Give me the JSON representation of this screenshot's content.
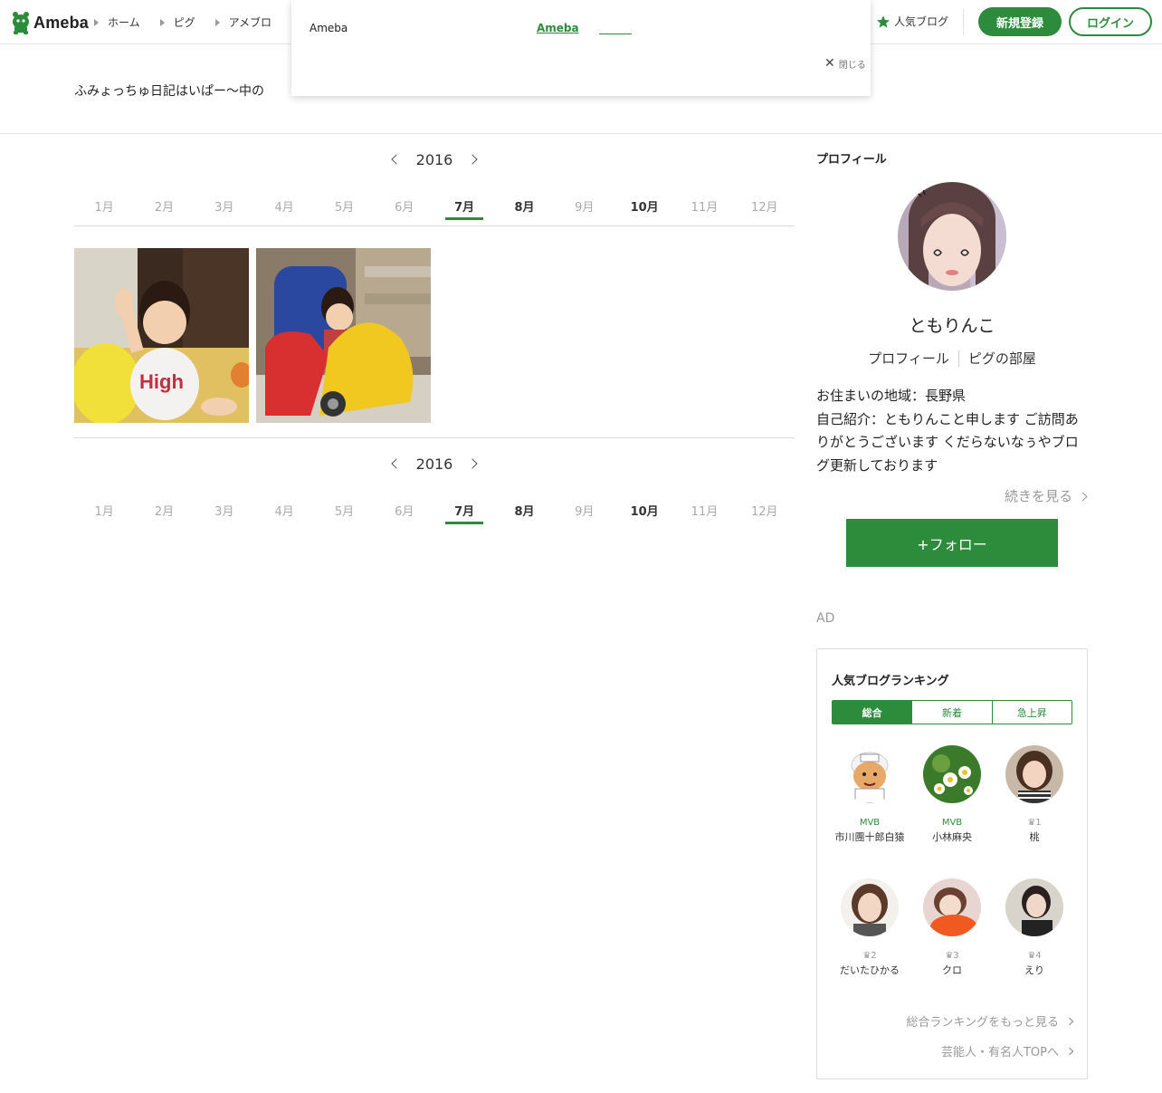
{
  "header": {
    "logo_text": "Ameba",
    "nav": [
      {
        "label": "ホーム"
      },
      {
        "label": "ピグ"
      },
      {
        "label": "アメブロ"
      }
    ],
    "popular_blog": "人気ブログ",
    "signup": "新規登録",
    "login": "ログイン"
  },
  "popup": {
    "left_text": "Ameba",
    "link_text": "Ameba",
    "close_text": "閉じる"
  },
  "blog_title": "ふみょっちゅ日記はいぱー〜中の",
  "archive": {
    "year": "2016",
    "months": [
      {
        "label": "1月",
        "has_posts": false
      },
      {
        "label": "2月",
        "has_posts": false
      },
      {
        "label": "3月",
        "has_posts": false
      },
      {
        "label": "4月",
        "has_posts": false
      },
      {
        "label": "5月",
        "has_posts": false
      },
      {
        "label": "6月",
        "has_posts": false
      },
      {
        "label": "7月",
        "has_posts": true,
        "active": true
      },
      {
        "label": "8月",
        "has_posts": true
      },
      {
        "label": "9月",
        "has_posts": false
      },
      {
        "label": "10月",
        "has_posts": true
      },
      {
        "label": "11月",
        "has_posts": false
      },
      {
        "label": "12月",
        "has_posts": false
      }
    ]
  },
  "profile": {
    "heading": "プロフィール",
    "name": "ともりんこ",
    "link_profile": "プロフィール",
    "link_room": "ピグの部屋",
    "region": "お住まいの地域：長野県",
    "intro": "自己紹介：ともりんこと申します ご訪問ありがとうございます くだらないなぅやブログ更新しております",
    "more": "続きを見る",
    "follow": "+フォロー"
  },
  "ad_label": "AD",
  "ranking": {
    "title": "人気ブログランキング",
    "tabs": [
      "総合",
      "新着",
      "急上昇"
    ],
    "items": [
      {
        "badge": "MVB",
        "name": "市川團十郎白猿"
      },
      {
        "badge": "MVB",
        "name": "小林麻央"
      },
      {
        "badge": "1",
        "name": "桃"
      },
      {
        "badge": "2",
        "name": "だいたひかる"
      },
      {
        "badge": "3",
        "name": "クロ"
      },
      {
        "badge": "4",
        "name": "えり"
      }
    ],
    "more_overall": "総合ランキングをもっと見る",
    "more_celeb": "芸能人・有名人TOPへ"
  },
  "colors": {
    "brand": "#2d8c3c"
  }
}
